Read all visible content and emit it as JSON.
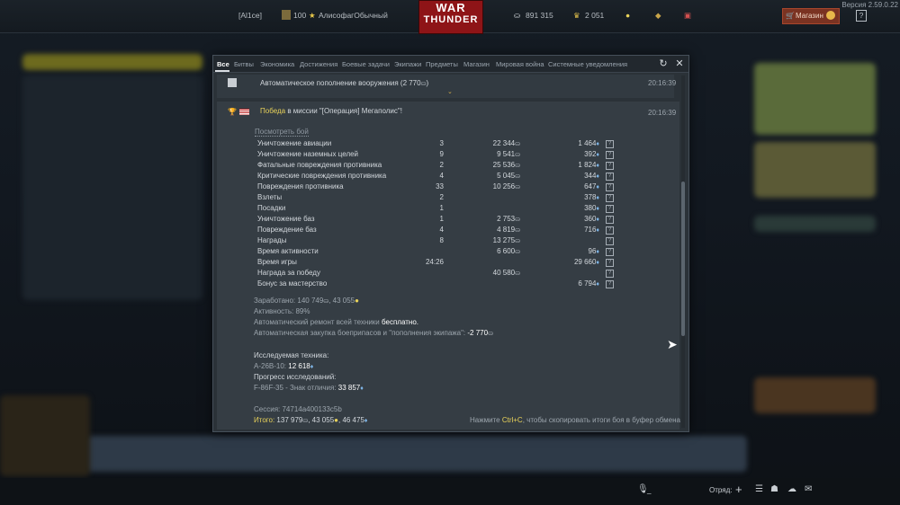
{
  "topbar": {
    "squad_tag": "[Al1ce]",
    "level": "100",
    "nickname": "АлисофагОбычный",
    "logo_line1": "WAR",
    "logo_line2": "THUNDER",
    "silver": "891 315",
    "gold": "2 051",
    "shop_label": "Магазин",
    "help_label": "?",
    "version": "Версия 2.59.0.22"
  },
  "tabs": [
    "Все",
    "Битвы",
    "Экономика",
    "Достижения",
    "Боевые задачи",
    "Экипажи",
    "Предметы",
    "Магазин",
    "Мировая война",
    "Системные уведомления"
  ],
  "message1": {
    "text": "Автоматическое пополнение вооружения (2 770",
    "close_paren": ")",
    "time": "20:16:39"
  },
  "message2": {
    "victory_word": "Победа",
    "title_rest": " в миссии \"[Операция] Мегаполис\"!",
    "time": "20:16:39",
    "view_battle": "Посмотреть бой",
    "rows": [
      {
        "label": "Уничтожение авиации",
        "count": "3",
        "silver": "22 344",
        "rp": "1 464"
      },
      {
        "label": "Уничтожение наземных целей",
        "count": "9",
        "silver": "9 541",
        "rp": "392"
      },
      {
        "label": "Фатальные повреждения противника",
        "count": "2",
        "silver": "25 536",
        "rp": "1 824"
      },
      {
        "label": "Критические повреждения противника",
        "count": "4",
        "silver": "5 045",
        "rp": "344"
      },
      {
        "label": "Повреждения противника",
        "count": "33",
        "silver": "10 256",
        "rp": "647"
      },
      {
        "label": "Взлеты",
        "count": "2",
        "silver": "",
        "rp": "378"
      },
      {
        "label": "Посадки",
        "count": "1",
        "silver": "",
        "rp": "380"
      },
      {
        "label": "Уничтожение баз",
        "count": "1",
        "silver": "2 753",
        "rp": "360"
      },
      {
        "label": "Повреждение баз",
        "count": "4",
        "silver": "4 819",
        "rp": "716"
      },
      {
        "label": "Награды",
        "count": "8",
        "silver": "13 275",
        "rp": ""
      },
      {
        "label": "Время активности",
        "count": "",
        "silver": "6 600",
        "rp": "96"
      },
      {
        "label": "Время игры",
        "count": "24:26",
        "silver": "",
        "rp": "29 660"
      },
      {
        "label": "Награда за победу",
        "count": "",
        "silver": "40 580",
        "rp": ""
      },
      {
        "label": "Бонус за мастерство",
        "count": "",
        "silver": "",
        "rp": "6 794"
      }
    ],
    "earned_label": "Заработано:",
    "earned_silver": "140 749",
    "earned_rp": "43 055",
    "activity": "Активность: 89%",
    "repair_text": "Автоматический ремонт всей техники",
    "repair_value": "бесплатно.",
    "purchase_text": "Автоматическая закупка боеприпасов и \"пополнения экипажа\":",
    "purchase_value": "-2 770",
    "researched_title": "Исследуемая техника:",
    "researched_vehicle": "А-26В-10:",
    "researched_value": "12 618",
    "progress_title": "Прогресс исследований:",
    "progress_vehicle": "F-86F-35 - Знак отличия:",
    "progress_value": "33 857",
    "session": "Сессия: 74714a400133c5b",
    "total_label": "Итого:",
    "total_silver": "137 979",
    "total_rp": "43 055",
    "total_free": "46 475",
    "hint_before": "Нажмите",
    "hint_key": "Ctrl+C",
    "hint_after": ", чтобы скопировать итоги боя в буфер обмена"
  },
  "bottombar": {
    "mic_label": "_",
    "squad_label": "Отряд:"
  }
}
